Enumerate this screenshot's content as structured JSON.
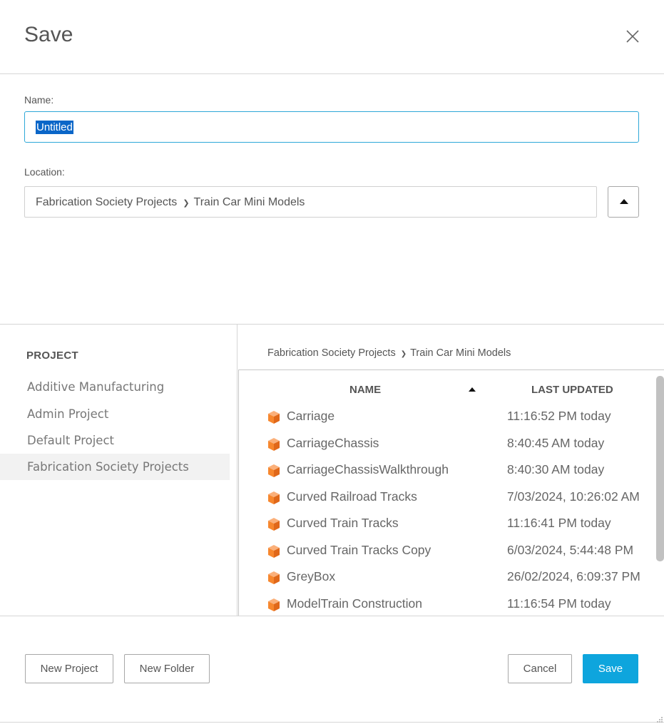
{
  "dialog": {
    "title": "Save",
    "close_icon": "close-icon"
  },
  "name_field": {
    "label": "Name:",
    "value": "Untitled"
  },
  "location_field": {
    "label": "Location:",
    "path": [
      "Fabrication Society Projects",
      "Train Car Mini Models"
    ],
    "collapse_icon": "triangle-up-icon"
  },
  "projects": {
    "heading": "PROJECT",
    "items": [
      {
        "label": "Additive Manufacturing",
        "active": false
      },
      {
        "label": "Admin Project",
        "active": false
      },
      {
        "label": "Default Project",
        "active": false
      },
      {
        "label": "Fabrication Society Projects",
        "active": true
      }
    ]
  },
  "browser": {
    "breadcrumb": [
      "Fabrication Society Projects",
      "Train Car Mini Models"
    ],
    "columns": {
      "name": "NAME",
      "updated": "LAST UPDATED",
      "sort_icon": "sort-ascending-icon"
    },
    "file_icon": "design-cube-icon",
    "rows": [
      {
        "name": "Carriage",
        "updated": "11:16:52 PM today"
      },
      {
        "name": "CarriageChassis",
        "updated": "8:40:45 AM today"
      },
      {
        "name": "CarriageChassisWalkthrough",
        "updated": "8:40:30 AM today"
      },
      {
        "name": "Curved Railroad Tracks",
        "updated": "7/03/2024, 10:26:02 AM"
      },
      {
        "name": "Curved Train Tracks",
        "updated": "11:16:41 PM today"
      },
      {
        "name": "Curved Train Tracks Copy",
        "updated": "6/03/2024, 5:44:48 PM"
      },
      {
        "name": "GreyBox",
        "updated": "26/02/2024, 6:09:37 PM"
      },
      {
        "name": "ModelTrain Construction",
        "updated": "11:16:54 PM today"
      }
    ]
  },
  "footer": {
    "new_project": "New Project",
    "new_folder": "New Folder",
    "cancel": "Cancel",
    "save": "Save"
  },
  "colors": {
    "accent": "#0ea5dd",
    "focus_border": "#2ea8d8",
    "cube_orange": "#f7872e"
  }
}
